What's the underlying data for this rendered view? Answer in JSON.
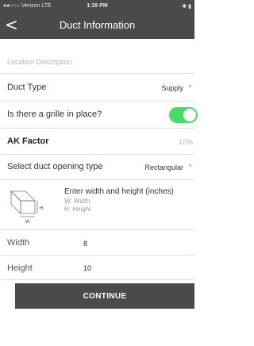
{
  "status_bar": {
    "carrier": "●●○○○ Verizon  LTE",
    "time": "1:39 PM",
    "right": "✱ ▮"
  },
  "nav": {
    "back_glyph": "<",
    "title": "Duct Information"
  },
  "form": {
    "location": {
      "placeholder": "Location Description"
    },
    "duct_type": {
      "label": "Duct Type",
      "value": "Supply"
    },
    "grille": {
      "label": "Is there a grille in place?",
      "on": true
    },
    "ak_factor": {
      "label": "AK Factor",
      "value": "10%"
    },
    "opening_type": {
      "label": "Select duct opening type",
      "value": "Rectangular"
    },
    "diagram": {
      "title": "Enter width and height (inches)",
      "width_hint": "W: Width",
      "height_hint": "H: Height",
      "label_h": "H",
      "label_w": "W"
    },
    "width": {
      "label": "Width",
      "value": "8"
    },
    "height": {
      "label": "Height",
      "value": "10"
    }
  },
  "continue_label": "CONTINUE",
  "colors": {
    "bar": "#4a4a4a",
    "toggle_on": "#4cd964"
  }
}
